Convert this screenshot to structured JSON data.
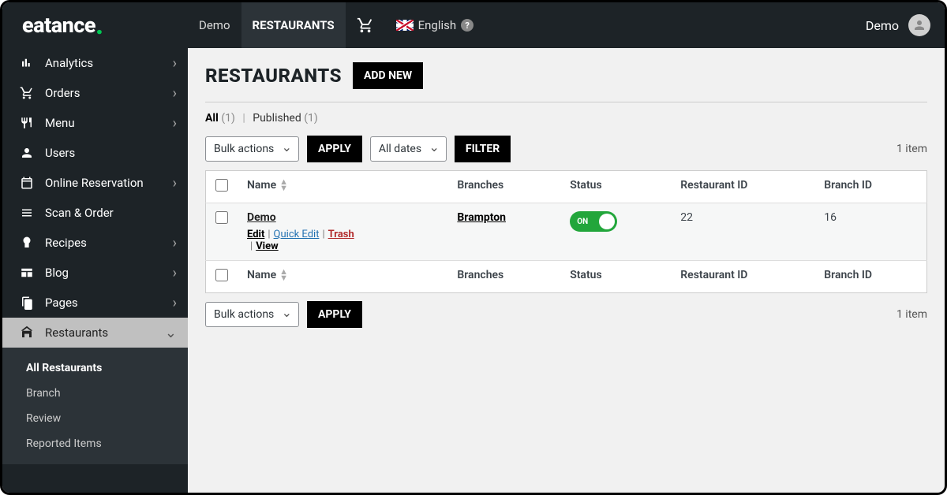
{
  "topbar": {
    "logo": "eatance",
    "nav": [
      {
        "label": "Demo"
      },
      {
        "label": "RESTAURANTS"
      }
    ],
    "language": "English",
    "user": "Demo"
  },
  "sidebar": {
    "items": [
      {
        "label": "Analytics",
        "icon": "analytics"
      },
      {
        "label": "Orders",
        "icon": "cart"
      },
      {
        "label": "Menu",
        "icon": "menu"
      },
      {
        "label": "Users",
        "icon": "user"
      },
      {
        "label": "Online Reservation",
        "icon": "calendar"
      },
      {
        "label": "Scan & Order",
        "icon": "scan"
      },
      {
        "label": "Recipes",
        "icon": "recipes"
      },
      {
        "label": "Blog",
        "icon": "blog"
      },
      {
        "label": "Pages",
        "icon": "pages"
      },
      {
        "label": "Restaurants",
        "icon": "store"
      }
    ],
    "submenu": [
      {
        "label": "All Restaurants"
      },
      {
        "label": "Branch"
      },
      {
        "label": "Review"
      },
      {
        "label": "Reported Items"
      }
    ]
  },
  "page": {
    "title": "RESTAURANTS",
    "add_new": "ADD NEW",
    "filters": {
      "all": "All",
      "all_count": "(1)",
      "published": "Published",
      "published_count": "(1)"
    },
    "bulk_actions": "Bulk actions",
    "apply": "APPLY",
    "all_dates": "All dates",
    "filter": "FILTER",
    "item_count": "1 item",
    "columns": {
      "name": "Name",
      "branches": "Branches",
      "status": "Status",
      "restaurant_id": "Restaurant ID",
      "branch_id": "Branch ID"
    },
    "row": {
      "name": "Demo",
      "branch": "Brampton",
      "status": "ON",
      "restaurant_id": "22",
      "branch_id": "16",
      "actions": {
        "edit": "Edit",
        "quick_edit": "Quick Edit",
        "trash": "Trash",
        "view": "View"
      }
    }
  }
}
